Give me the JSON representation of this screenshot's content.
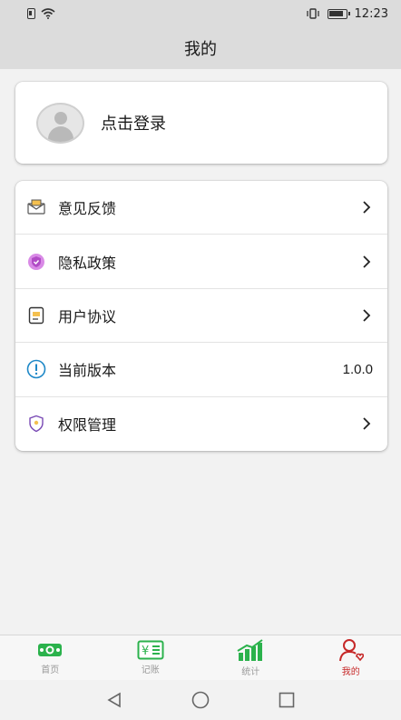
{
  "status": {
    "time": "12:23"
  },
  "header": {
    "title": "我的"
  },
  "login": {
    "text": "点击登录",
    "avatar_icon": "user-avatar-icon"
  },
  "menu": {
    "items": [
      {
        "label": "意见反馈",
        "icon": "feedback-mail-icon",
        "value": ""
      },
      {
        "label": "隐私政策",
        "icon": "privacy-shield-icon",
        "value": ""
      },
      {
        "label": "用户协议",
        "icon": "agreement-note-icon",
        "value": ""
      },
      {
        "label": "当前版本",
        "icon": "info-icon",
        "value": "1.0.0"
      },
      {
        "label": "权限管理",
        "icon": "permission-shield-icon",
        "value": ""
      }
    ]
  },
  "tabs": [
    {
      "label": "首页",
      "icon": "money-icon",
      "active": false
    },
    {
      "label": "记账",
      "icon": "ledger-icon",
      "active": false
    },
    {
      "label": "统计",
      "icon": "chart-icon",
      "active": false
    },
    {
      "label": "我的",
      "icon": "profile-icon",
      "active": true
    }
  ],
  "colors": {
    "accent_green": "#2bb24c",
    "active_red": "#c62828",
    "info_blue": "#1e88c7",
    "privacy_purple": "#c46bd8"
  }
}
